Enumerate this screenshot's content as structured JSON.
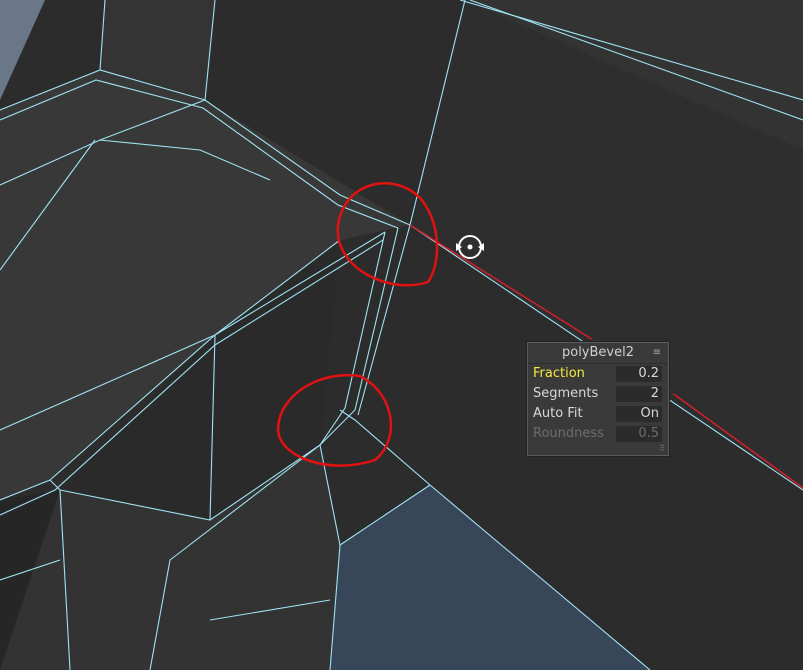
{
  "viewport": {
    "colors": {
      "surface_light": "#3b3b3b",
      "surface_mid": "#333333",
      "surface_dark": "#252525",
      "wireframe": "#9fe3f2",
      "axis_guide": "#d21f2c",
      "annotation": "#e01212",
      "backdrop_blue": "#3e4c5e"
    },
    "annotations": [
      "circle-top-corner",
      "circle-bottom-corner"
    ],
    "manipulator_icon": "rotate-manipulator-icon"
  },
  "hud": {
    "title": "polyBevel2",
    "menu_icon": "≡",
    "rows": [
      {
        "label": "Fraction",
        "value": "0.2",
        "state": "active"
      },
      {
        "label": "Segments",
        "value": "2",
        "state": "normal"
      },
      {
        "label": "Auto Fit",
        "value": "On",
        "state": "normal"
      },
      {
        "label": "Roundness",
        "value": "0.5",
        "state": "disabled"
      }
    ]
  }
}
